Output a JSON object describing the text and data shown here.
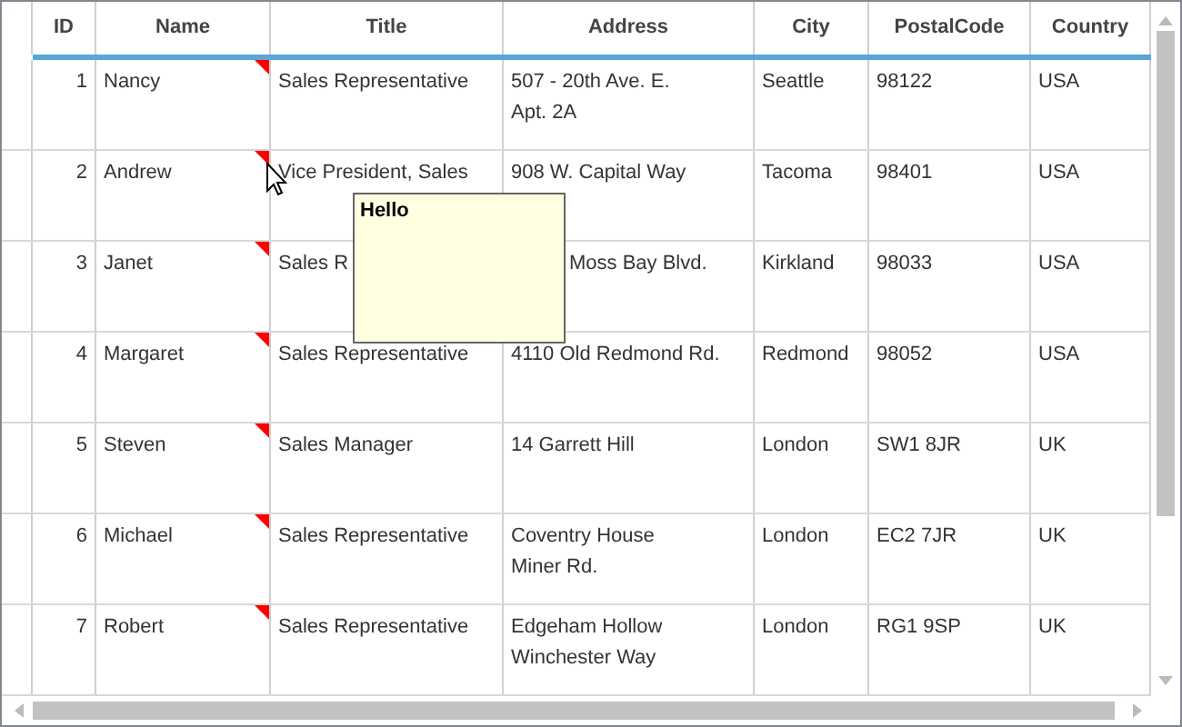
{
  "grid": {
    "columns": [
      "ID",
      "Name",
      "Title",
      "Address",
      "City",
      "PostalCode",
      "Country"
    ],
    "rows": [
      {
        "cells": [
          "1",
          "Nancy",
          "Sales Representative",
          "507 - 20th Ave. E.\nApt. 2A",
          "Seattle",
          "98122",
          "USA"
        ],
        "commented": true
      },
      {
        "cells": [
          "2",
          "Andrew",
          "Vice President, Sales",
          "908 W. Capital Way",
          "Tacoma",
          "98401",
          "USA"
        ],
        "commented": true
      },
      {
        "cells": [
          "3",
          "Janet",
          "Sales R",
          "Moss Bay Blvd.",
          "Kirkland",
          "98033",
          "USA"
        ],
        "commented": true,
        "obscured": true
      },
      {
        "cells": [
          "4",
          "Margaret",
          "Sales Representative",
          "4110 Old Redmond Rd.",
          "Redmond",
          "98052",
          "USA"
        ],
        "commented": true
      },
      {
        "cells": [
          "5",
          "Steven",
          "Sales Manager",
          "14 Garrett Hill",
          "London",
          "SW1 8JR",
          "UK"
        ],
        "commented": true
      },
      {
        "cells": [
          "6",
          "Michael",
          "Sales Representative",
          "Coventry House\nMiner Rd.",
          "London",
          "EC2 7JR",
          "UK"
        ],
        "commented": true
      },
      {
        "cells": [
          "7",
          "Robert",
          "Sales Representative",
          "Edgeham Hollow\nWinchester Way",
          "London",
          "RG1 9SP",
          "UK"
        ],
        "commented": true
      }
    ]
  },
  "tooltip": {
    "text": "Hello"
  }
}
